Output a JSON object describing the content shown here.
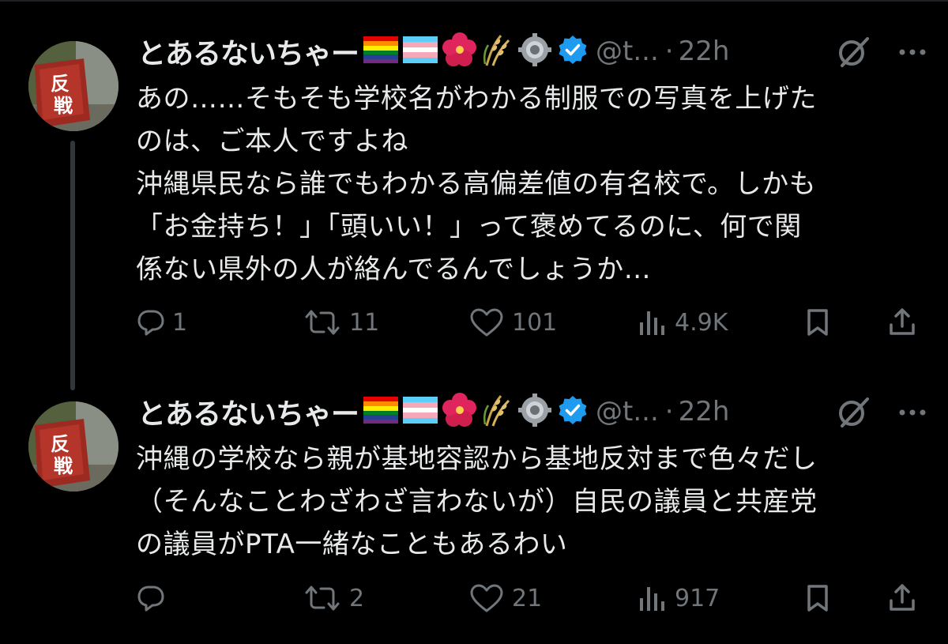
{
  "colors": {
    "background": "#000000",
    "text": "#e7e9ea",
    "muted": "#71767b",
    "verified": "#1d9bf0",
    "thread_line": "#333639"
  },
  "tweets": [
    {
      "display_name": "とあるないちゃー",
      "emojis": [
        "rainbow-flag",
        "transgender-flag",
        "hibiscus",
        "rice-ear",
        "gear"
      ],
      "handle": "@t...",
      "separator": "·",
      "time": "22h",
      "avatar_text_top": "反",
      "avatar_text_bottom": "戦",
      "lines": [
        "あの……そもそも学校名がわかる制服での写真を上げた",
        "のは、ご本人ですよね",
        "沖縄県民なら誰でもわかる高偏差値の有名校で。しかも",
        "「お金持ち！」「頭いい！」って褒めてるのに、何で関",
        "係ない県外の人が絡んでるんでしょうか…"
      ],
      "replies": "1",
      "reposts": "11",
      "likes": "101",
      "views": "4.9K"
    },
    {
      "display_name": "とあるないちゃー",
      "emojis": [
        "rainbow-flag",
        "transgender-flag",
        "hibiscus",
        "rice-ear",
        "gear"
      ],
      "handle": "@t...",
      "separator": "·",
      "time": "22h",
      "avatar_text_top": "反",
      "avatar_text_bottom": "戦",
      "lines": [
        "沖縄の学校なら親が基地容認から基地反対まで色々だし",
        "（そんなことわざわざ言わないが）自民の議員と共産党",
        "の議員がPTA一緒なこともあるわい"
      ],
      "replies": "",
      "reposts": "2",
      "likes": "21",
      "views": "917"
    }
  ]
}
